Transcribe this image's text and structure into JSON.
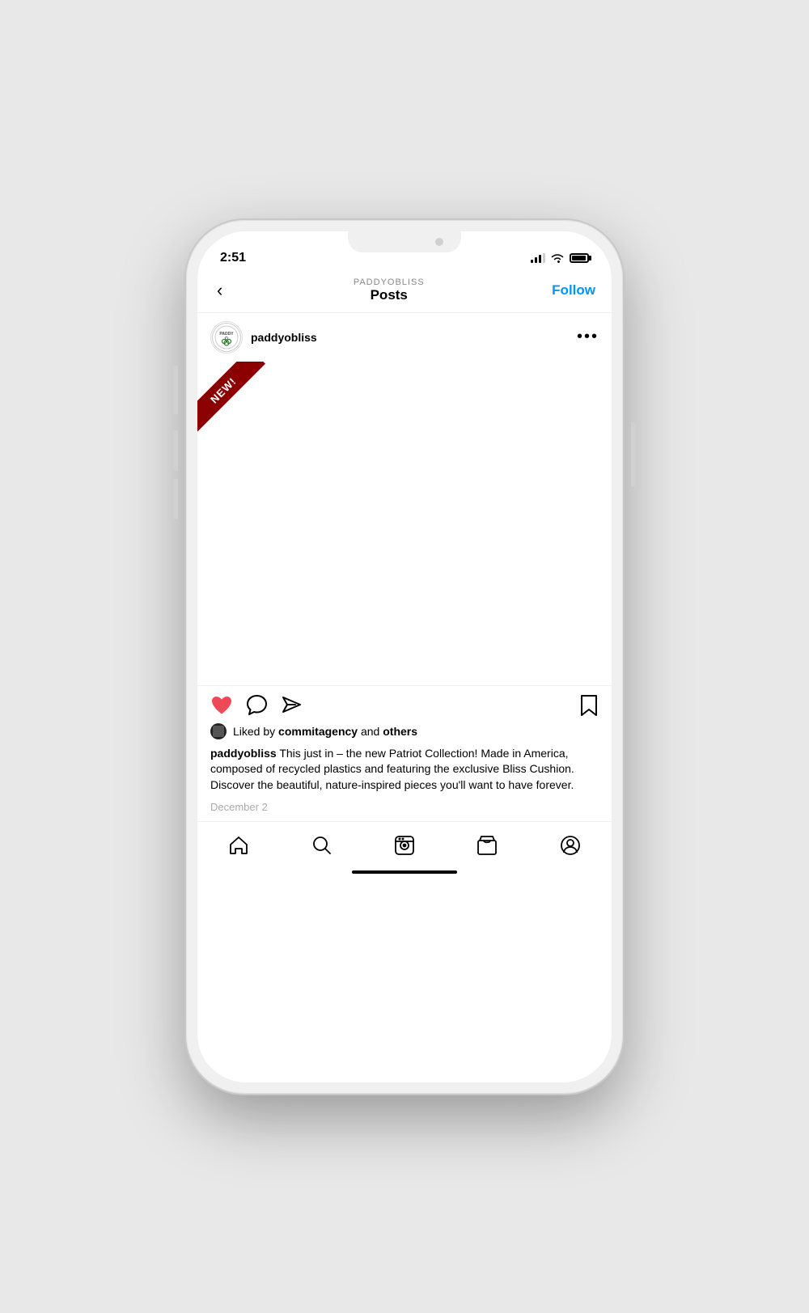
{
  "phone": {
    "status": {
      "time": "2:51",
      "signal_label": "signal",
      "wifi_label": "wifi",
      "battery_label": "battery"
    }
  },
  "header": {
    "back_label": "‹",
    "username_small": "PADDYOBLISS",
    "posts_label": "Posts",
    "follow_label": "Follow"
  },
  "post": {
    "username": "paddyobliss",
    "more_icon_label": "•••",
    "ribbon_text": "NEW!",
    "likes": {
      "liked_by_prefix": "Liked by ",
      "liked_by_user": "commitagency",
      "liked_by_suffix": " and ",
      "liked_by_others": "others"
    },
    "caption": {
      "username": "paddyobliss",
      "text": " This just in – the new Patriot Collection! Made in America, composed of recycled plastics and featuring the exclusive Bliss Cushion. Discover the beautiful, nature-inspired pieces you'll want to have forever."
    },
    "timestamp": "December 2"
  },
  "bottom_nav": {
    "home_label": "home",
    "search_label": "search",
    "reels_label": "reels",
    "shop_label": "shop",
    "profile_label": "profile"
  }
}
